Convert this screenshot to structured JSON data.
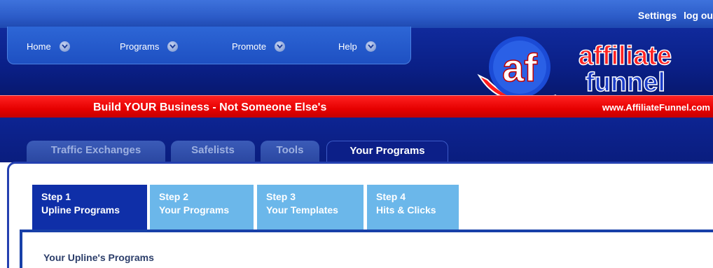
{
  "top_links": {
    "settings": "Settings",
    "logout": "log ou"
  },
  "nav": [
    {
      "label": "Home",
      "icon": "chevron-down-icon"
    },
    {
      "label": "Programs",
      "icon": "chevron-down-icon"
    },
    {
      "label": "Promote",
      "icon": "chevron-down-icon"
    },
    {
      "label": "Help",
      "icon": "chevron-down-icon"
    }
  ],
  "logo": {
    "badge": "af",
    "line1": "affiliate",
    "line2": "funnel"
  },
  "banner": {
    "tagline": "Build YOUR Business - Not Someone Else's",
    "url": "www.AffiliateFunnel.com"
  },
  "program_tabs": [
    "Traffic Exchanges",
    "Safelists",
    "Tools",
    "Your Programs"
  ],
  "steps": [
    {
      "num": "Step 1",
      "label": "Upline Programs"
    },
    {
      "num": "Step 2",
      "label": "Your Programs"
    },
    {
      "num": "Step 3",
      "label": "Your Templates"
    },
    {
      "num": "Step 4",
      "label": "Hits & Clicks"
    }
  ],
  "section_title": "Your Upline's Programs",
  "colors": {
    "header_blue": "#0a1f86",
    "banner_red": "#e60000",
    "step_active": "#0f2fa8",
    "step_inactive": "#6bb7ea"
  }
}
